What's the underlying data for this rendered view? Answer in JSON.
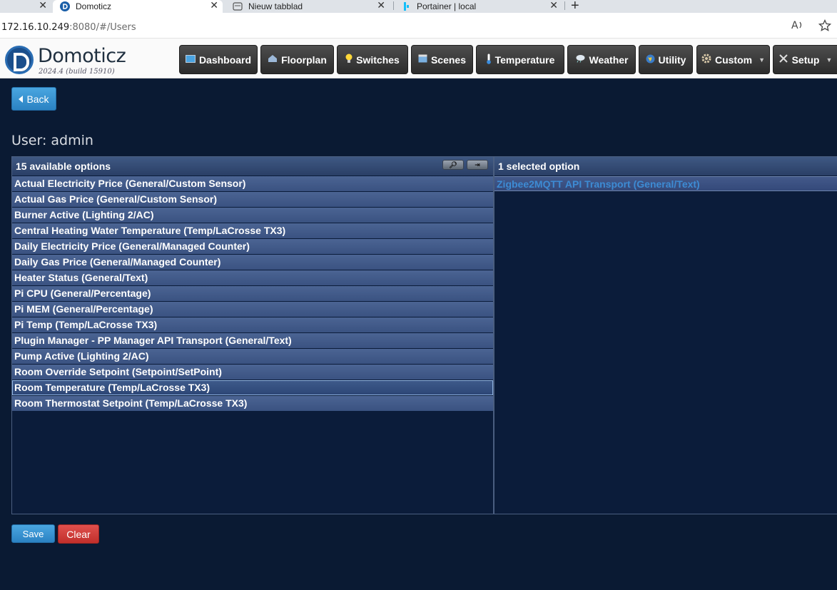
{
  "browser": {
    "tabs": [
      {
        "label": ""
      },
      {
        "label": "Domoticz"
      },
      {
        "label": "Nieuw tabblad"
      },
      {
        "label": "Portainer | local"
      }
    ],
    "url_host": "172.16.10.249",
    "url_rest": ":8080/#/Users"
  },
  "app": {
    "brand": "Domoticz",
    "version": "2024.4 (build 15910)",
    "nav": [
      {
        "label": "Dashboard",
        "icon": "dashboard-icon"
      },
      {
        "label": "Floorplan",
        "icon": "house-icon"
      },
      {
        "label": "Switches",
        "icon": "lightbulb-icon"
      },
      {
        "label": "Scenes",
        "icon": "clapper-icon"
      },
      {
        "label": "Temperature",
        "icon": "thermometer-icon"
      },
      {
        "label": "Weather",
        "icon": "cloud-icon"
      },
      {
        "label": "Utility",
        "icon": "globe-icon"
      },
      {
        "label": "Custom",
        "icon": "gear-icon"
      },
      {
        "label": "Setup",
        "icon": "tools-icon"
      }
    ]
  },
  "page": {
    "back_label": "Back",
    "title": "User: admin",
    "available_header": "15 available options",
    "selected_header": "1 selected option",
    "available": [
      "Actual Electricity Price (General/Custom Sensor)",
      "Actual Gas Price (General/Custom Sensor)",
      "Burner Active (Lighting 2/AC)",
      "Central Heating Water Temperature (Temp/LaCrosse TX3)",
      "Daily Electricity Price (General/Managed Counter)",
      "Daily Gas Price (General/Managed Counter)",
      "Heater Status (General/Text)",
      "Pi CPU (General/Percentage)",
      "Pi MEM (General/Percentage)",
      "Pi Temp (Temp/LaCrosse TX3)",
      "Plugin Manager - PP Manager API Transport (General/Text)",
      "Pump Active (Lighting 2/AC)",
      "Room Override Setpoint (Setpoint/SetPoint)",
      "Room Temperature (Temp/LaCrosse TX3)",
      "Room Thermostat Setpoint (Temp/LaCrosse TX3)"
    ],
    "selected": [
      "Zigbee2MQTT API Transport (General/Text)"
    ],
    "save_label": "Save",
    "clear_label": "Clear"
  }
}
